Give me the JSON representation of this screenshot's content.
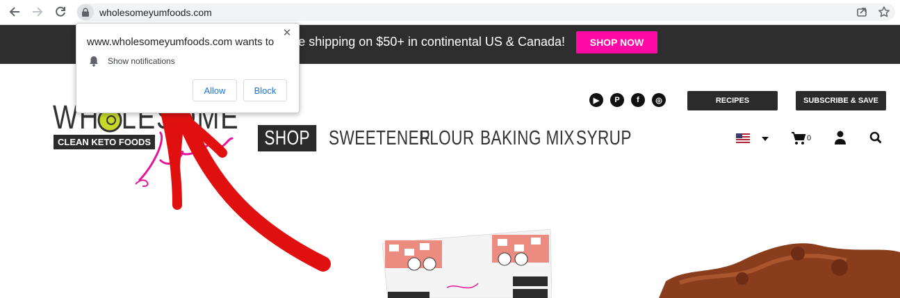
{
  "browser": {
    "url": "wholesomeyumfoods.com",
    "back_icon": "back-arrow-icon",
    "forward_icon": "forward-arrow-icon",
    "reload_icon": "reload-icon",
    "lock_icon": "lock-icon",
    "share_icon": "share-icon",
    "bookmark_icon": "star-icon"
  },
  "promo": {
    "text": "e shipping on $50+ in continental US & Canada!",
    "button": "SHOP NOW",
    "button_color": "#ff0aa5",
    "bar_color": "#2e2e2e"
  },
  "logo": {
    "word": "WHOLESOME",
    "tagline": "CLEAN KETO FOODS",
    "script": "yum",
    "script_color": "#e5159a"
  },
  "header": {
    "social_icons": [
      "youtube-icon",
      "pinterest-icon",
      "facebook-icon",
      "instagram-icon"
    ],
    "recipes": "RECIPES",
    "subscribe": "SUBSCRIBE & SAVE",
    "cart_count": "0"
  },
  "nav": {
    "items": [
      "SHOP",
      "SWEETENER",
      "FLOUR",
      "BAKING MIX",
      "SYRUP"
    ]
  },
  "permission": {
    "title": "www.wholesomeyumfoods.com wants to",
    "label": "Show notifications",
    "allow": "Allow",
    "block": "Block",
    "close": "✕"
  },
  "annotation": {
    "arrow_color": "#e01010"
  }
}
